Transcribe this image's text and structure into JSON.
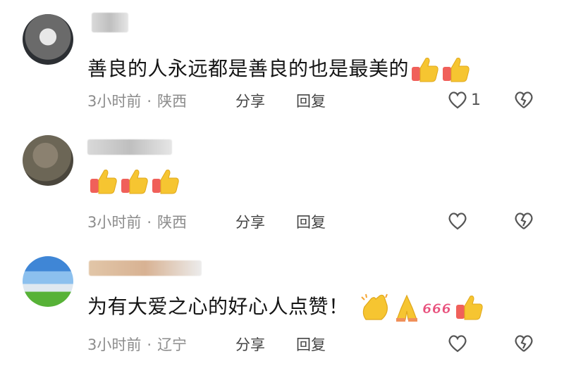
{
  "comments": [
    {
      "text": "善良的人永远都是善良的也是最美的",
      "emojis": [
        "thumbs-up",
        "thumbs-up"
      ],
      "time": "3小时前",
      "separator": "·",
      "location": "陕西",
      "share_label": "分享",
      "reply_label": "回复",
      "like_count": "1"
    },
    {
      "text": "",
      "emojis": [
        "thumbs-up",
        "thumbs-up",
        "thumbs-up"
      ],
      "time": "3小时前",
      "separator": "·",
      "location": "陕西",
      "share_label": "分享",
      "reply_label": "回复",
      "like_count": ""
    },
    {
      "text": "为有大爱之心的好心人点赞！",
      "emojis": [
        "clapping-hands",
        "folded-hands",
        "666",
        "thumbs-up"
      ],
      "time": "3小时前",
      "separator": "·",
      "location": "辽宁",
      "share_label": "分享",
      "reply_label": "回复",
      "like_count": ""
    }
  ],
  "colors": {
    "thumb_yellow": "#f6c531",
    "thumb_red": "#f0605a",
    "meta_gray": "#8c8c8c"
  }
}
